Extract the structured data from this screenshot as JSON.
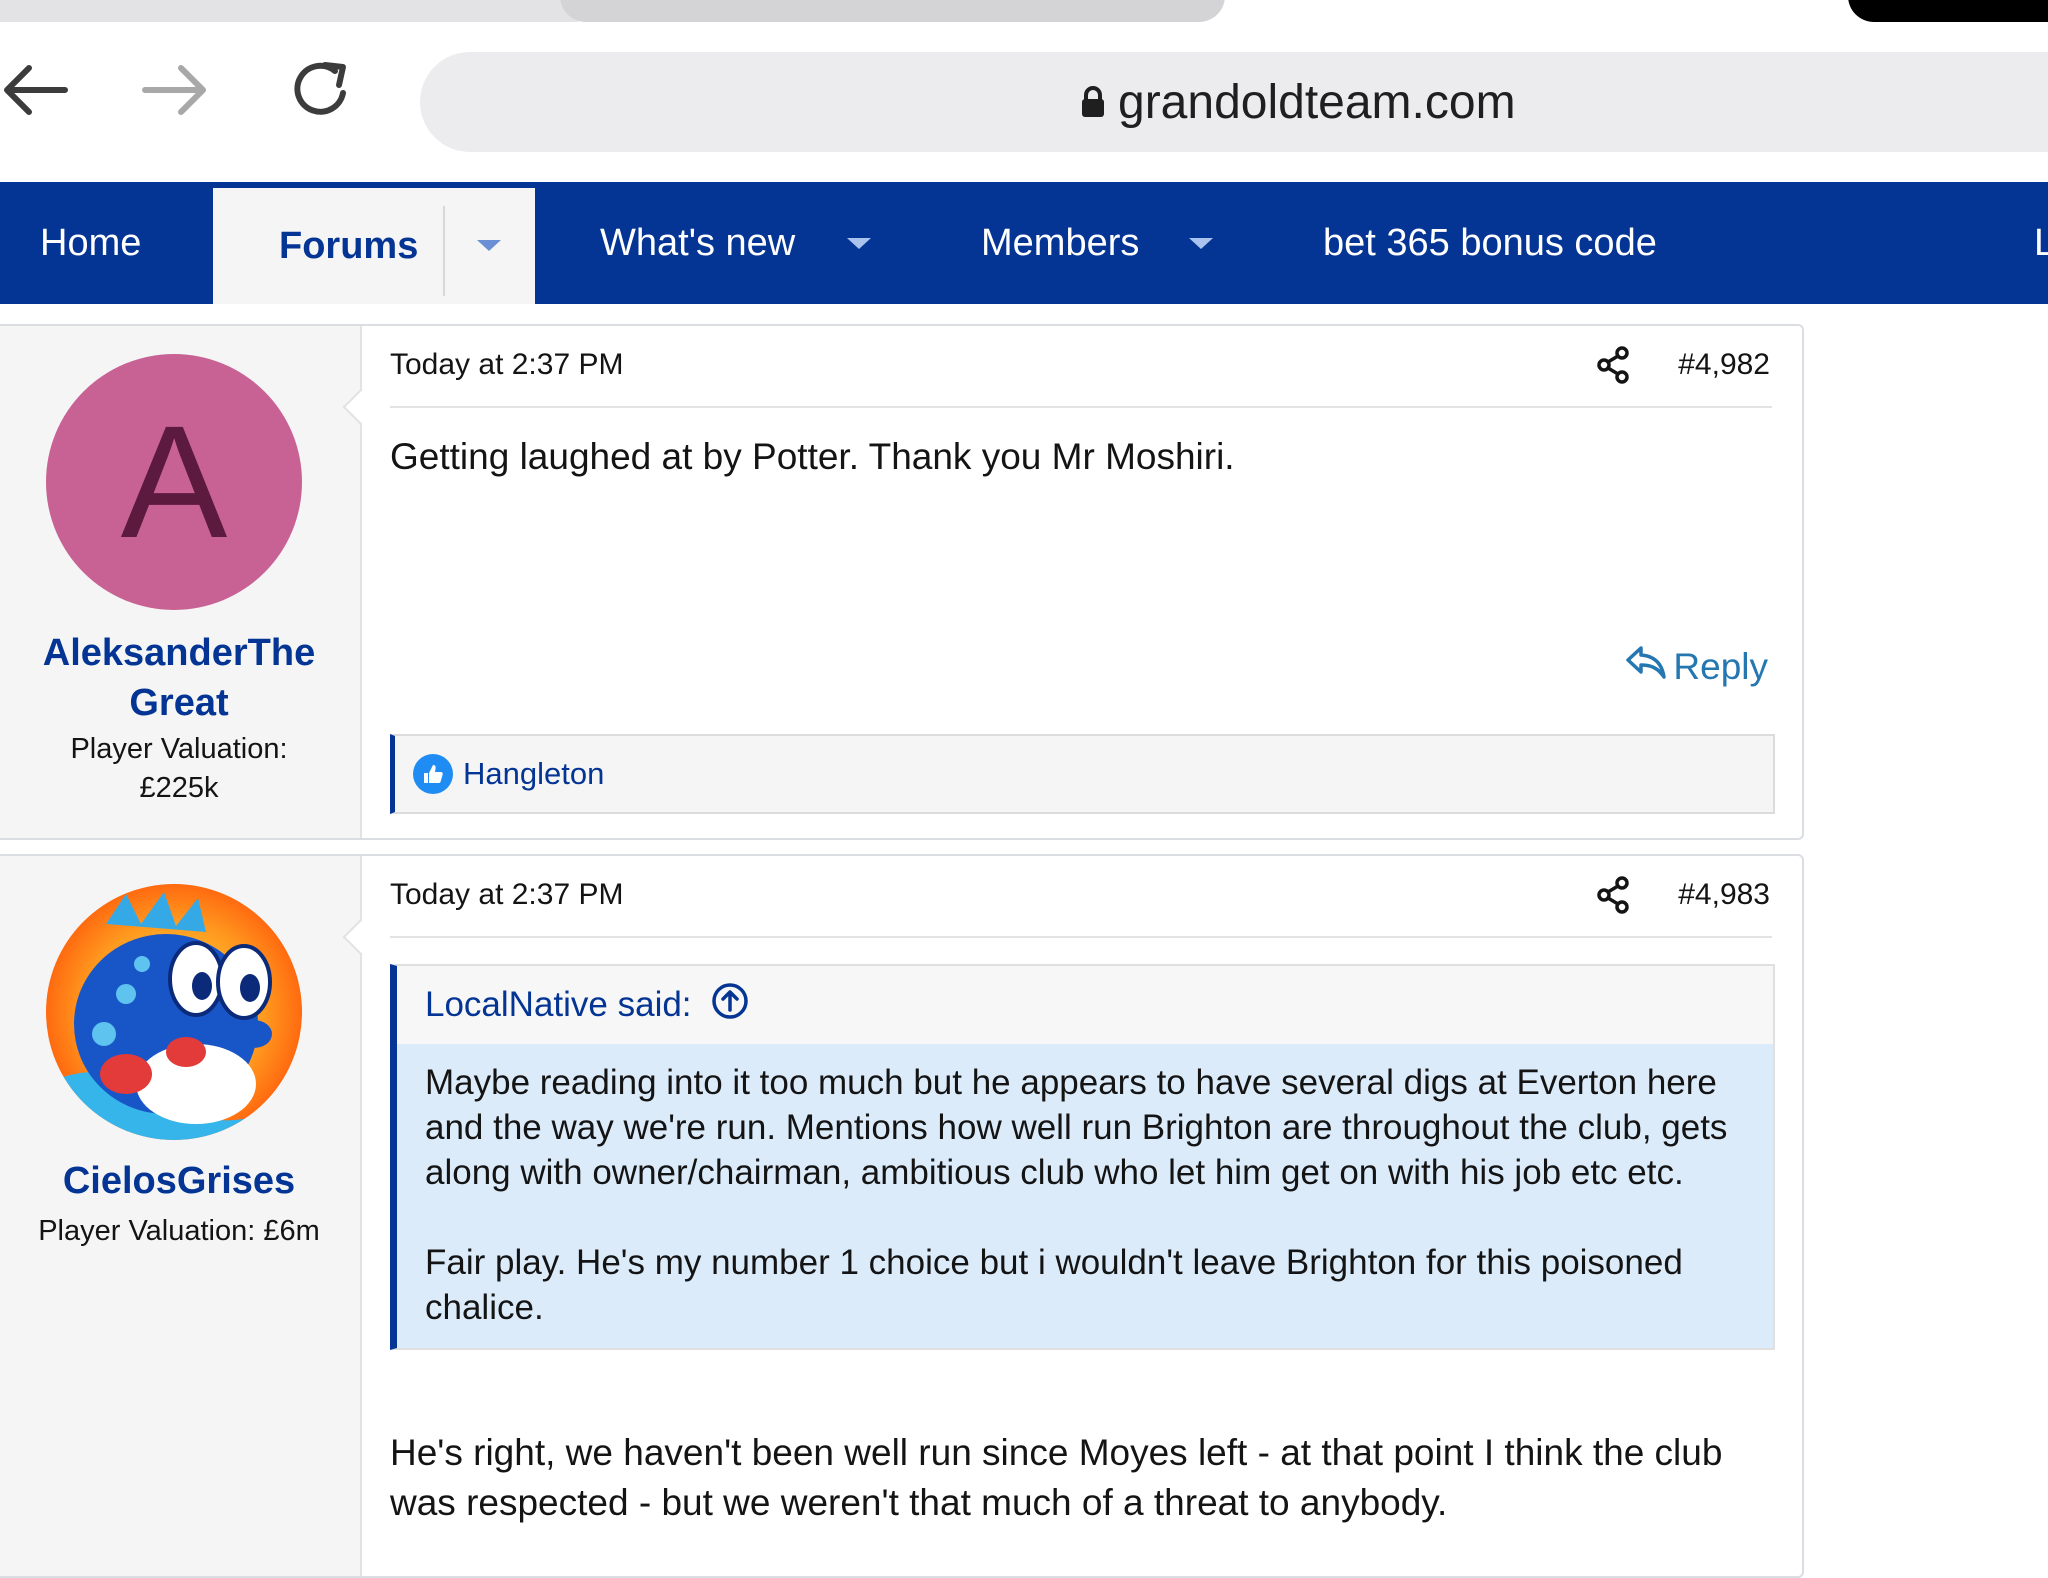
{
  "browser": {
    "url": "grandoldteam.com"
  },
  "nav": {
    "items": [
      {
        "label": "Home"
      },
      {
        "label": "Forums"
      },
      {
        "label": "What's new"
      },
      {
        "label": "Members"
      },
      {
        "label": "bet 365 bonus code"
      },
      {
        "label": "L"
      }
    ]
  },
  "posts": [
    {
      "avatar_letter": "A",
      "username_line1": "AleksanderThe",
      "username_line2": "Great",
      "user_title_line1": "Player Valuation:",
      "user_title_line2": "£225k",
      "date": "Today at 2:37 PM",
      "number": "#4,982",
      "text": "Getting laughed at by Potter. Thank you Mr Moshiri.",
      "reply_label": "Reply",
      "reaction_user": "Hangleton"
    },
    {
      "username": "CielosGrises",
      "user_title": "Player Valuation: £6m",
      "date": "Today at 2:37 PM",
      "number": "#4,983",
      "quote_author": "LocalNative said:",
      "quote_paragraphs": [
        "Maybe reading into it too much but he appears to have several digs at Everton here and the way we're run. Mentions how well run Brighton are throughout the club, gets along with owner/chairman, ambitious club who let him get on with his job etc etc.",
        "Fair play. He's my number 1 choice but i wouldn't leave Brighton for this poisoned chalice."
      ],
      "text": "He's right, we haven't been well run since Moyes left - at that point I think the club was respected - but we weren't that much of a threat to anybody."
    }
  ],
  "colors": {
    "brand_blue": "#043594",
    "link_blue": "#2577b1",
    "avatar_pink": "#c86294",
    "quote_bg": "#dcebfa"
  }
}
